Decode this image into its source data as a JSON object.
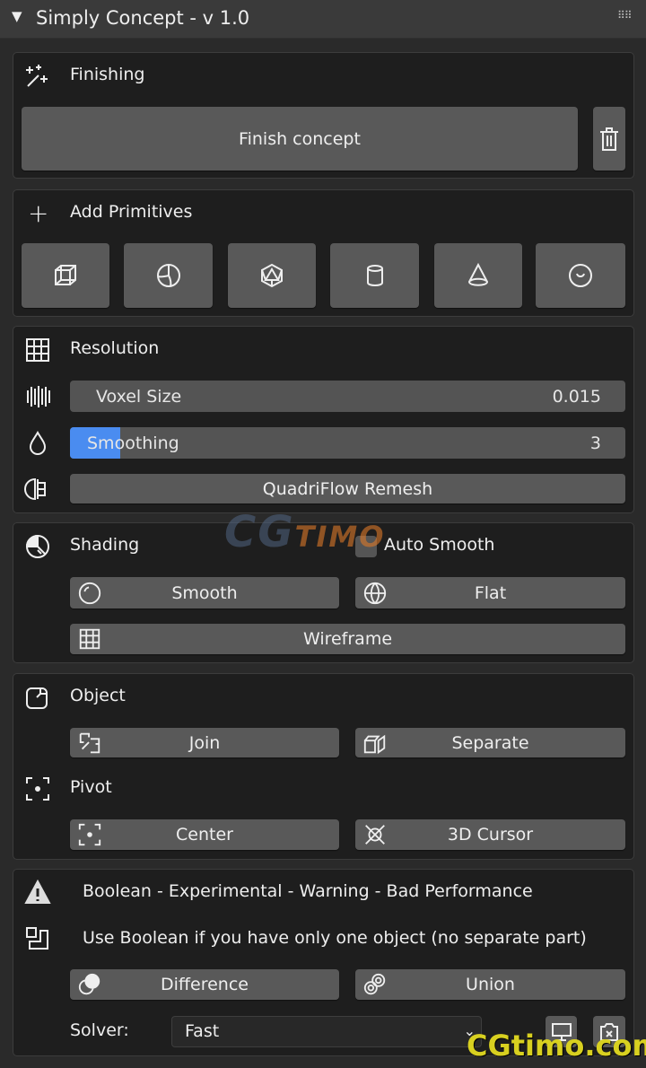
{
  "header": {
    "title": "Simply Concept - v 1.0",
    "collapse_icon": "triangle-down-icon",
    "drag_icon": "grip-icon"
  },
  "finishing": {
    "title": "Finishing",
    "icon": "magic-wand-icon",
    "finish_label": "Finish concept",
    "delete_icon": "trash-icon"
  },
  "primitives": {
    "title": "Add Primitives",
    "icon": "plus-icon",
    "items": [
      "cube-icon",
      "uv-sphere-icon",
      "ico-sphere-icon",
      "cylinder-icon",
      "cone-icon",
      "torus-icon"
    ]
  },
  "resolution": {
    "title": "Resolution",
    "icon": "grid-icon",
    "voxel": {
      "label": "Voxel Size",
      "value": "0.015"
    },
    "smoothing": {
      "label": "Smoothing",
      "value": "3",
      "fill_percent": 9,
      "fill_color": "#4a8cf0"
    },
    "remesh_label": "QuadriFlow Remesh"
  },
  "shading": {
    "title": "Shading",
    "auto_smooth_label": "Auto Smooth",
    "auto_smooth_checked": false,
    "smooth_label": "Smooth",
    "flat_label": "Flat",
    "wireframe_label": "Wireframe"
  },
  "object": {
    "title": "Object",
    "join_label": "Join",
    "separate_label": "Separate"
  },
  "pivot": {
    "title": "Pivot",
    "center_label": "Center",
    "cursor_label": "3D Cursor"
  },
  "boolean": {
    "warning": "Boolean - Experimental - Warning - Bad Performance",
    "hint": "Use Boolean if you have only one object (no separate part)",
    "difference_label": "Difference",
    "union_label": "Union",
    "solver_label": "Solver:",
    "solver_value": "Fast"
  },
  "watermarks": [
    "CGTIMO",
    "CGtimo.com"
  ]
}
